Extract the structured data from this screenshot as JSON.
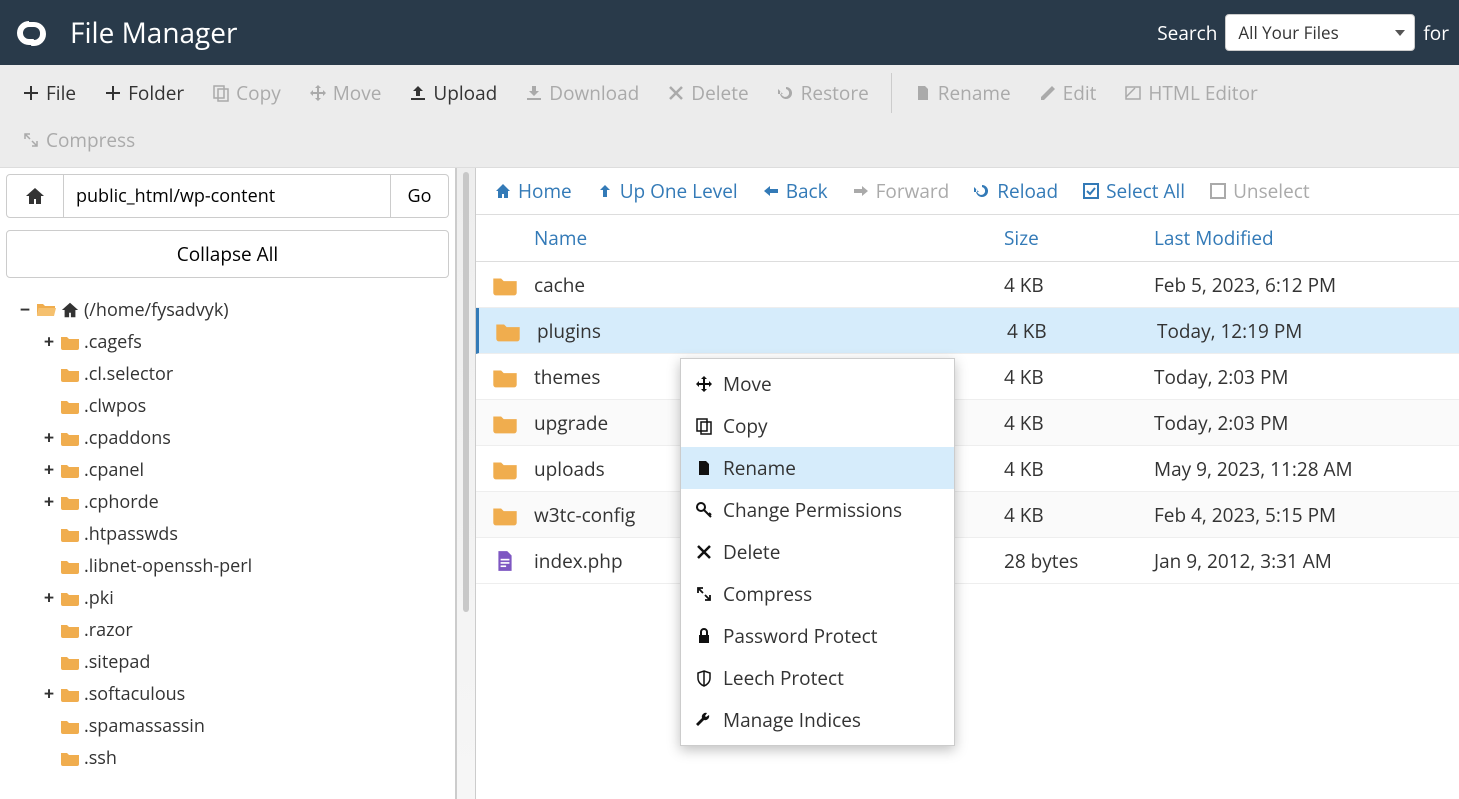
{
  "header": {
    "title": "File Manager",
    "search_label": "Search",
    "search_for_label": "for",
    "search_selected": "All Your Files"
  },
  "toolbar": {
    "file": "File",
    "folder": "Folder",
    "copy": "Copy",
    "move": "Move",
    "upload": "Upload",
    "download": "Download",
    "delete": "Delete",
    "restore": "Restore",
    "rename": "Rename",
    "edit": "Edit",
    "html_editor": "HTML Editor",
    "compress": "Compress"
  },
  "sidebar": {
    "path_value": "public_html/wp-content",
    "go_label": "Go",
    "collapse_label": "Collapse All",
    "root_label": "(/home/fysadvyk)",
    "tree": [
      {
        "label": ".cagefs",
        "expandable": true
      },
      {
        "label": ".cl.selector",
        "expandable": false
      },
      {
        "label": ".clwpos",
        "expandable": false
      },
      {
        "label": ".cpaddons",
        "expandable": true
      },
      {
        "label": ".cpanel",
        "expandable": true
      },
      {
        "label": ".cphorde",
        "expandable": true
      },
      {
        "label": ".htpasswds",
        "expandable": false
      },
      {
        "label": ".libnet-openssh-perl",
        "expandable": false
      },
      {
        "label": ".pki",
        "expandable": true
      },
      {
        "label": ".razor",
        "expandable": false
      },
      {
        "label": ".sitepad",
        "expandable": false
      },
      {
        "label": ".softaculous",
        "expandable": true
      },
      {
        "label": ".spamassassin",
        "expandable": false
      },
      {
        "label": ".ssh",
        "expandable": false
      }
    ]
  },
  "nav": {
    "home": "Home",
    "up": "Up One Level",
    "back": "Back",
    "forward": "Forward",
    "reload": "Reload",
    "select_all": "Select All",
    "unselect": "Unselect"
  },
  "columns": {
    "name": "Name",
    "size": "Size",
    "modified": "Last Modified"
  },
  "files": [
    {
      "name": "cache",
      "size": "4 KB",
      "modified": "Feb 5, 2023, 6:12 PM",
      "type": "folder"
    },
    {
      "name": "plugins",
      "size": "4 KB",
      "modified": "Today, 12:19 PM",
      "type": "folder",
      "selected": true
    },
    {
      "name": "themes",
      "size": "4 KB",
      "modified": "Today, 2:03 PM",
      "type": "folder"
    },
    {
      "name": "upgrade",
      "size": "4 KB",
      "modified": "Today, 2:03 PM",
      "type": "folder"
    },
    {
      "name": "uploads",
      "size": "4 KB",
      "modified": "May 9, 2023, 11:28 AM",
      "type": "folder"
    },
    {
      "name": "w3tc-config",
      "size": "4 KB",
      "modified": "Feb 4, 2023, 5:15 PM",
      "type": "folder"
    },
    {
      "name": "index.php",
      "size": "28 bytes",
      "modified": "Jan 9, 2012, 3:31 AM",
      "type": "file"
    }
  ],
  "context_menu": {
    "move": "Move",
    "copy": "Copy",
    "rename": "Rename",
    "change_permissions": "Change Permissions",
    "delete": "Delete",
    "compress": "Compress",
    "password_protect": "Password Protect",
    "leech_protect": "Leech Protect",
    "manage_indices": "Manage Indices"
  }
}
